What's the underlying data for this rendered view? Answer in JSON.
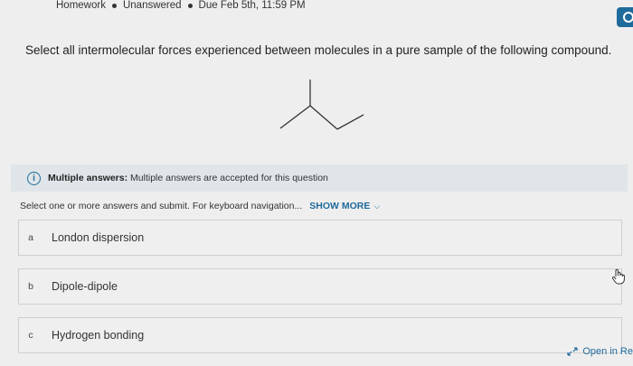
{
  "meta": {
    "type": "Homework",
    "status": "Unanswered",
    "due": "Due Feb 5th, 11:59 PM"
  },
  "question": {
    "text": "Select all intermolecular forces experienced between molecules in a pure sample of the following compound."
  },
  "info": {
    "title": "Multiple answers:",
    "text": "Multiple answers are accepted for this question"
  },
  "instructions": {
    "text": "Select one or more answers and submit. For keyboard navigation...",
    "show_more": "SHOW MORE"
  },
  "options": [
    {
      "letter": "a",
      "label": "London dispersion"
    },
    {
      "letter": "b",
      "label": "Dipole-dipole"
    },
    {
      "letter": "c",
      "label": "Hydrogen bonding"
    }
  ],
  "footer": {
    "open_in": "Open in Re"
  },
  "colors": {
    "accent": "#1f6b9c",
    "info_bar": "#dfe5e8",
    "background": "#eeeeee"
  }
}
